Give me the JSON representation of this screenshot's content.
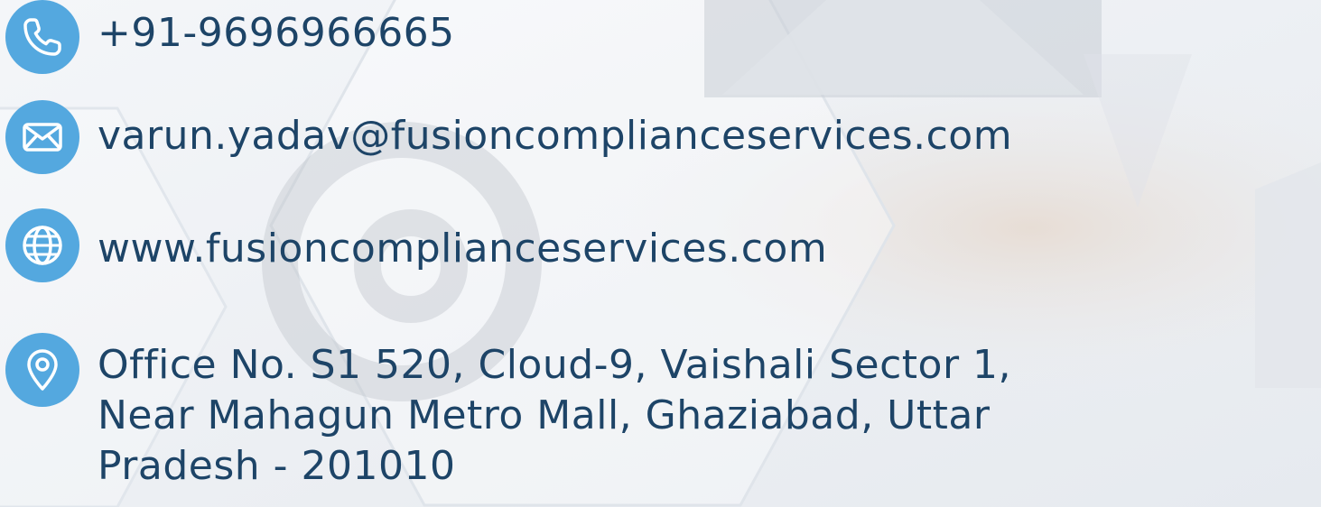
{
  "contact": {
    "phone": "+91-9696966665",
    "email": "varun.yadav@fusioncomplianceservices.com",
    "website": "www.fusioncomplianceservices.com",
    "address_line1": "Office No. S1 520, Cloud-9, Vaishali Sector 1,",
    "address_line2": "Near Mahagun Metro Mall, Ghaziabad, Uttar",
    "address_line3": "Pradesh - 201010"
  },
  "icons": {
    "phone": "phone-icon",
    "email": "envelope-icon",
    "website": "globe-icon",
    "address": "location-pin-icon"
  },
  "colors": {
    "icon_bg": "#54a8df",
    "text": "#1d4467",
    "background": "#eef1f5"
  }
}
